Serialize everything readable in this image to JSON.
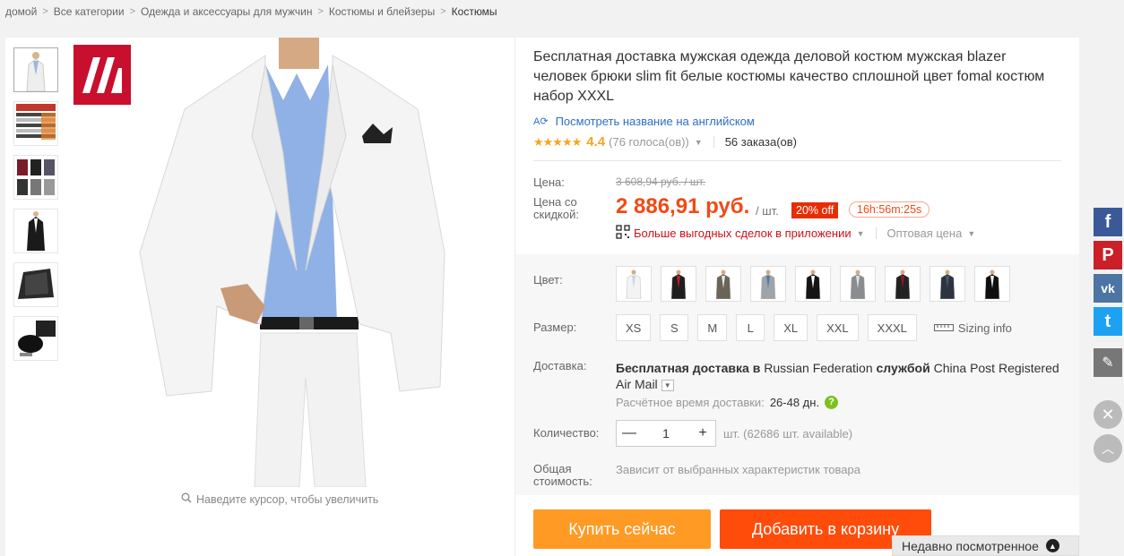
{
  "breadcrumb": [
    {
      "label": "домой"
    },
    {
      "label": "Все категории"
    },
    {
      "label": "Одежда и аксессуары для мужчин"
    },
    {
      "label": "Костюмы и блейзеры"
    },
    {
      "label": "Костюмы"
    }
  ],
  "gallery": {
    "zoom_hint": "Наведите курсор, чтобы увеличить",
    "thumbnail_count": 6
  },
  "product": {
    "title": "Бесплатная доставка мужская одежда деловой костюм мужская blazer человек брюки slim fit белые костюмы качество сплошной цвет fomal костюм набор XXXL",
    "translate_link": "Посмотреть название на английском",
    "translate_icon_text": "A⟳",
    "rating_stars": "★★★★★",
    "rating_value": "4.4",
    "votes": "(76 голоса(ов))",
    "orders": "56 заказа(ов)"
  },
  "pricing": {
    "price_label": "Цена:",
    "old_price": "3 608,94 руб. / шт.",
    "discount_price_label": "Цена со скидкой:",
    "new_price": "2 886,91 руб.",
    "per_unit": "/ шт.",
    "discount_badge": "20% off",
    "timer": "16h:56m:25s",
    "app_deals": "Больше выгодных сделок в приложении",
    "wholesale": "Оптовая цена"
  },
  "options": {
    "color_label": "Цвет:",
    "colors": [
      {
        "name": "white",
        "jacket": "#f3f3f3",
        "shirt": "#c9d6e8"
      },
      {
        "name": "black-red",
        "jacket": "#1e1e1e",
        "shirt": "#c41e2a"
      },
      {
        "name": "grey-brown",
        "jacket": "#6b6258",
        "shirt": "#e8e8e8"
      },
      {
        "name": "light-grey",
        "jacket": "#9ea4ab",
        "shirt": "#5577aa"
      },
      {
        "name": "black-white",
        "jacket": "#151515",
        "shirt": "#ffffff"
      },
      {
        "name": "grey",
        "jacket": "#8a8c8f",
        "shirt": "#e0e0e0"
      },
      {
        "name": "black-wine",
        "jacket": "#222222",
        "shirt": "#8b1a2a"
      },
      {
        "name": "navy-check",
        "jacket": "#2b3440",
        "shirt": "#4a5a6a"
      },
      {
        "name": "black",
        "jacket": "#0f0f0f",
        "shirt": "#f0f0f0"
      }
    ],
    "size_label": "Размер:",
    "sizes": [
      "XS",
      "S",
      "M",
      "L",
      "XL",
      "XXL",
      "XXXL"
    ],
    "sizing_info": "Sizing info",
    "shipping_label": "Доставка:",
    "shipping_free": "Бесплатная доставка в",
    "shipping_country": "Russian Federation",
    "shipping_via": "службой",
    "shipping_carrier": "China Post Registered Air Mail",
    "delivery_time_label": "Расчётное время доставки:",
    "delivery_time_value": "26-48 дн.",
    "quantity_label": "Количество:",
    "quantity_value": "1",
    "quantity_minus": "—",
    "quantity_plus": "+",
    "quantity_note": "шт. (62686 шт. available)",
    "total_label": "Общая стоимость:",
    "total_note": "Зависит от выбранных характеристик товара"
  },
  "actions": {
    "buy_now": "Купить сейчас",
    "add_to_cart": "Добавить в корзину"
  },
  "social": [
    {
      "name": "facebook",
      "glyph": "f",
      "color": "#3b5998"
    },
    {
      "name": "pinterest",
      "glyph": "P",
      "color": "#cb2027"
    },
    {
      "name": "vk",
      "glyph": "vk",
      "color": "#4c75a3"
    },
    {
      "name": "twitter",
      "glyph": "t",
      "color": "#1da1f2"
    },
    {
      "name": "edit",
      "glyph": "✎",
      "color": "#777777"
    }
  ],
  "recent": {
    "label": "Недавно посмотренное",
    "toggle": "▲"
  },
  "colors": {
    "accent_orange": "#ff9a24",
    "accent_red": "#ff4c0a",
    "price_red": "#f04a14",
    "link_blue": "#2a6fc7"
  }
}
